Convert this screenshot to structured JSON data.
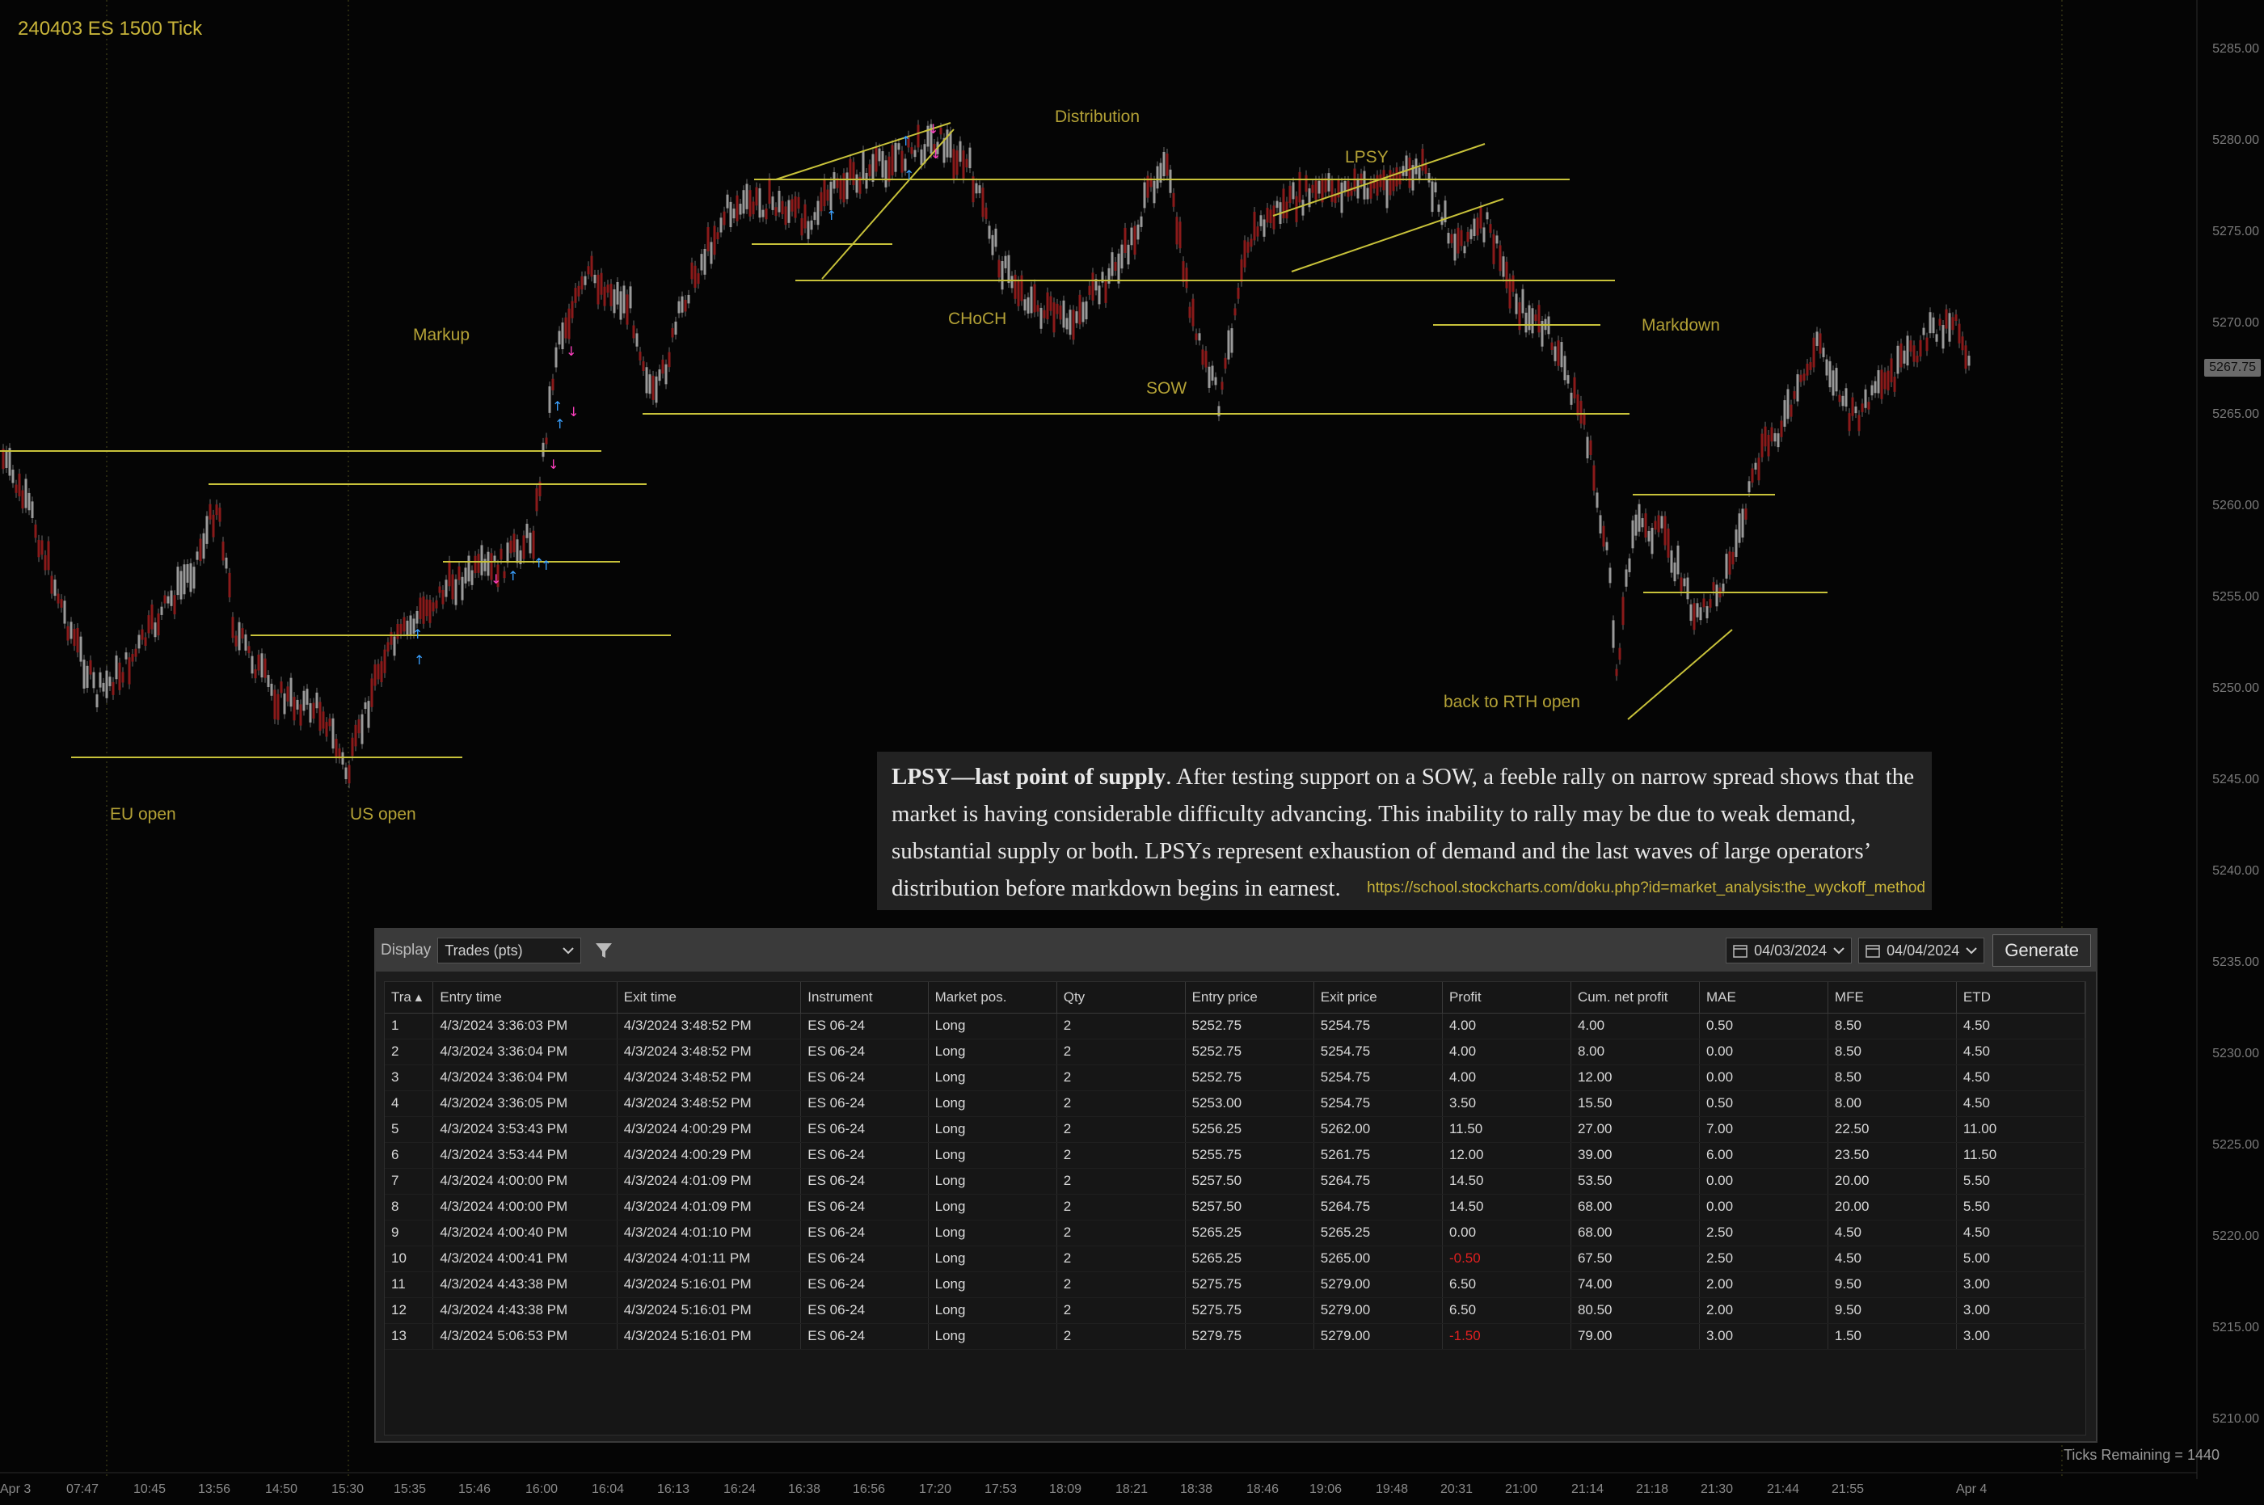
{
  "chart": {
    "title": "240403 ES 1500 Tick",
    "annotations": {
      "eu_open": "EU open",
      "us_open": "US open",
      "markup": "Markup",
      "distribution": "Distribution",
      "lpsy": "LPSY",
      "choch": "CHoCH",
      "sow": "SOW",
      "markdown": "Markdown",
      "back_to_rth": "back to RTH open"
    },
    "price_axis": [
      "5285.00",
      "5280.00",
      "5275.00",
      "5270.00",
      "5265.00",
      "5260.00",
      "5255.00",
      "5250.00",
      "5245.00",
      "5240.00",
      "5235.00",
      "5230.00",
      "5225.00",
      "5220.00",
      "5215.00",
      "5210.00"
    ],
    "current_price": "5267.75",
    "time_axis": [
      "Apr 3",
      "07:47",
      "10:45",
      "13:56",
      "14:50",
      "15:30",
      "15:35",
      "15:46",
      "16:00",
      "16:04",
      "16:13",
      "16:24",
      "16:38",
      "16:56",
      "17:20",
      "17:53",
      "18:09",
      "18:21",
      "18:38",
      "18:46",
      "19:06",
      "19:48",
      "20:31",
      "21:00",
      "21:14",
      "21:18",
      "21:30",
      "21:44",
      "21:55",
      "Apr 4"
    ],
    "colors": {
      "annotation": "#b3a136",
      "lines": "#c8c23a",
      "candles": "#8a8a8a",
      "down": "#8a1a1a",
      "buy_marker": "#3aa0ff",
      "sell_marker": "#ff40c0"
    }
  },
  "quote": {
    "bold": "LPSY—last point of supply",
    "text": ". After testing support on a SOW, a feeble rally on narrow spread shows that the market is having considerable difficulty advancing. This inability to rally may be due to weak demand, substantial supply or both. LPSYs represent exhaustion of demand and the last waves of large operators’ distribution before markdown begins in earnest.",
    "link": "https://school.stockcharts.com/doku.php?id=market_analysis:the_wyckoff_method"
  },
  "panel": {
    "display_label": "Display",
    "display_value": "Trades (pts)",
    "filter_icon": "funnel-icon",
    "date_from": "04/03/2024",
    "date_to": "04/04/2024",
    "generate_label": "Generate",
    "columns": [
      "Tra",
      "Entry time",
      "Exit time",
      "Instrument",
      "Market pos.",
      "Qty",
      "Entry price",
      "Exit price",
      "Profit",
      "Cum. net profit",
      "MAE",
      "MFE",
      "ETD"
    ],
    "rows": [
      [
        "1",
        "4/3/2024 3:36:03 PM",
        "4/3/2024 3:48:52 PM",
        "ES 06-24",
        "Long",
        "2",
        "5252.75",
        "5254.75",
        "4.00",
        "4.00",
        "0.50",
        "8.50",
        "4.50"
      ],
      [
        "2",
        "4/3/2024 3:36:04 PM",
        "4/3/2024 3:48:52 PM",
        "ES 06-24",
        "Long",
        "2",
        "5252.75",
        "5254.75",
        "4.00",
        "8.00",
        "0.00",
        "8.50",
        "4.50"
      ],
      [
        "3",
        "4/3/2024 3:36:04 PM",
        "4/3/2024 3:48:52 PM",
        "ES 06-24",
        "Long",
        "2",
        "5252.75",
        "5254.75",
        "4.00",
        "12.00",
        "0.00",
        "8.50",
        "4.50"
      ],
      [
        "4",
        "4/3/2024 3:36:05 PM",
        "4/3/2024 3:48:52 PM",
        "ES 06-24",
        "Long",
        "2",
        "5253.00",
        "5254.75",
        "3.50",
        "15.50",
        "0.50",
        "8.00",
        "4.50"
      ],
      [
        "5",
        "4/3/2024 3:53:43 PM",
        "4/3/2024 4:00:29 PM",
        "ES 06-24",
        "Long",
        "2",
        "5256.25",
        "5262.00",
        "11.50",
        "27.00",
        "7.00",
        "22.50",
        "11.00"
      ],
      [
        "6",
        "4/3/2024 3:53:44 PM",
        "4/3/2024 4:00:29 PM",
        "ES 06-24",
        "Long",
        "2",
        "5255.75",
        "5261.75",
        "12.00",
        "39.00",
        "6.00",
        "23.50",
        "11.50"
      ],
      [
        "7",
        "4/3/2024 4:00:00 PM",
        "4/3/2024 4:01:09 PM",
        "ES 06-24",
        "Long",
        "2",
        "5257.50",
        "5264.75",
        "14.50",
        "53.50",
        "0.00",
        "20.00",
        "5.50"
      ],
      [
        "8",
        "4/3/2024 4:00:00 PM",
        "4/3/2024 4:01:09 PM",
        "ES 06-24",
        "Long",
        "2",
        "5257.50",
        "5264.75",
        "14.50",
        "68.00",
        "0.00",
        "20.00",
        "5.50"
      ],
      [
        "9",
        "4/3/2024 4:00:40 PM",
        "4/3/2024 4:01:10 PM",
        "ES 06-24",
        "Long",
        "2",
        "5265.25",
        "5265.25",
        "0.00",
        "68.00",
        "2.50",
        "4.50",
        "4.50"
      ],
      [
        "10",
        "4/3/2024 4:00:41 PM",
        "4/3/2024 4:01:11 PM",
        "ES 06-24",
        "Long",
        "2",
        "5265.25",
        "5265.00",
        "-0.50",
        "67.50",
        "2.50",
        "4.50",
        "5.00"
      ],
      [
        "11",
        "4/3/2024 4:43:38 PM",
        "4/3/2024 5:16:01 PM",
        "ES 06-24",
        "Long",
        "2",
        "5275.75",
        "5279.00",
        "6.50",
        "74.00",
        "2.00",
        "9.50",
        "3.00"
      ],
      [
        "12",
        "4/3/2024 4:43:38 PM",
        "4/3/2024 5:16:01 PM",
        "ES 06-24",
        "Long",
        "2",
        "5275.75",
        "5279.00",
        "6.50",
        "80.50",
        "2.00",
        "9.50",
        "3.00"
      ],
      [
        "13",
        "4/3/2024 5:06:53 PM",
        "4/3/2024 5:16:01 PM",
        "ES 06-24",
        "Long",
        "2",
        "5279.75",
        "5279.00",
        "-1.50",
        "79.00",
        "3.00",
        "1.50",
        "3.00"
      ]
    ]
  },
  "status": {
    "ticks_remaining": "Ticks Remaining = 1440"
  }
}
